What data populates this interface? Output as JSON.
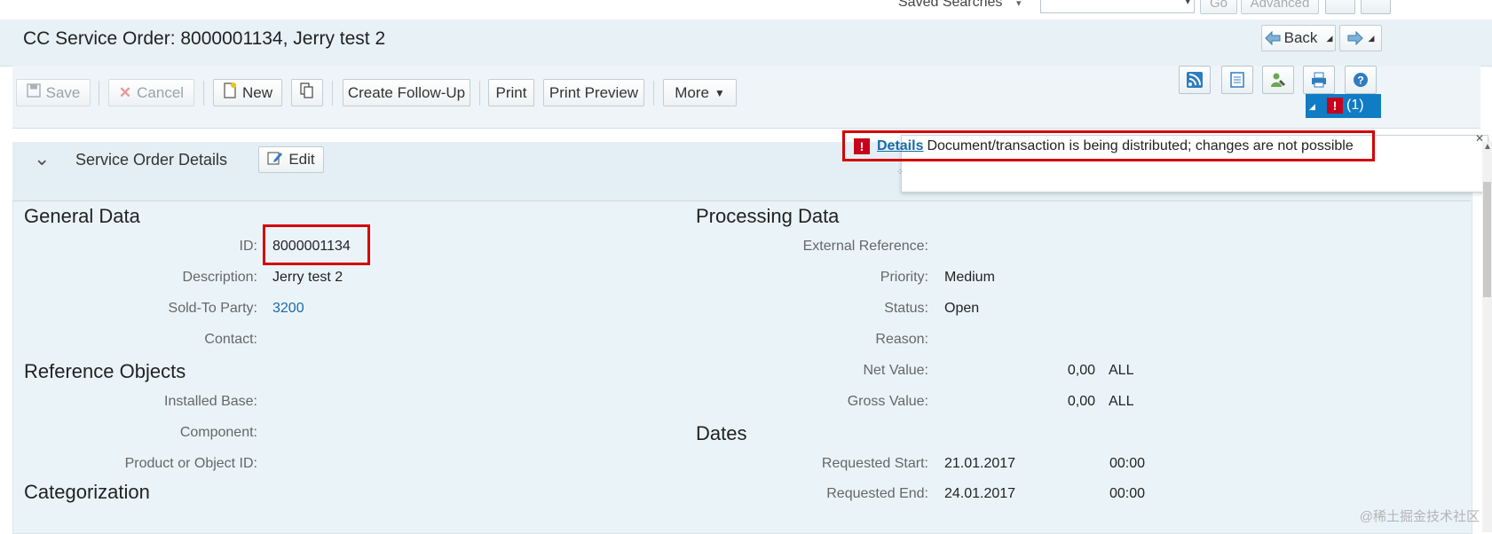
{
  "top": {
    "saved_searches_label": "Saved Searches",
    "go_label": "Go",
    "advanced_label": "Advanced"
  },
  "title": "CC Service Order: 8000001134, Jerry test 2",
  "nav": {
    "back_label": "Back"
  },
  "toolbar": {
    "save_label": "Save",
    "cancel_label": "Cancel",
    "new_label": "New",
    "create_follow_up_label": "Create Follow-Up",
    "print_label": "Print",
    "print_preview_label": "Print Preview",
    "more_label": "More",
    "message_count": "(1)"
  },
  "message": {
    "link": "Details",
    "text": "Document/transaction is being distributed; changes are not possible"
  },
  "panel": {
    "title": "Service Order Details",
    "edit_label": "Edit"
  },
  "general": {
    "title": "General Data",
    "fields": [
      {
        "label": "ID:",
        "value": "8000001134"
      },
      {
        "label": "Description:",
        "value": "Jerry test 2"
      },
      {
        "label": "Sold-To Party:",
        "value": "3200"
      },
      {
        "label": "Contact:",
        "value": ""
      }
    ]
  },
  "reference": {
    "title": "Reference Objects",
    "fields": [
      {
        "label": "Installed Base:",
        "value": ""
      },
      {
        "label": "Component:",
        "value": ""
      },
      {
        "label": "Product or Object ID:",
        "value": ""
      }
    ]
  },
  "categorization": {
    "title": "Categorization"
  },
  "processing": {
    "title": "Processing Data",
    "fields": [
      {
        "label": "External Reference:",
        "value": ""
      },
      {
        "label": "Priority:",
        "value": "Medium"
      },
      {
        "label": "Status:",
        "value": "Open"
      },
      {
        "label": "Reason:",
        "value": ""
      },
      {
        "label": "Net Value:",
        "amount": "0,00",
        "currency": "ALL"
      },
      {
        "label": "Gross Value:",
        "amount": "0,00",
        "currency": "ALL"
      }
    ]
  },
  "dates": {
    "title": "Dates",
    "fields": [
      {
        "label": "Requested Start:",
        "date": "21.01.2017",
        "time": "00:00"
      },
      {
        "label": "Requested End:",
        "date": "24.01.2017",
        "time": "00:00"
      }
    ]
  },
  "watermark": "@稀土掘金技术社区",
  "colors": {
    "accent": "#1a6aa8",
    "error": "#c8001c",
    "highlight": "#d40000",
    "message_bar": "#0f7cc4"
  }
}
